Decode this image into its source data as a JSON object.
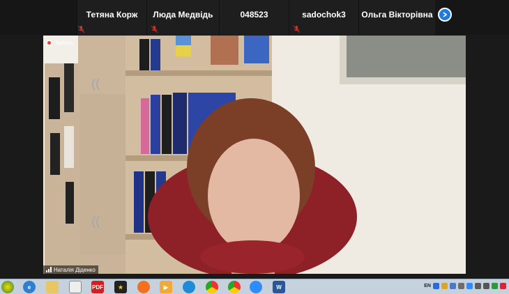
{
  "participants": [
    {
      "name": "Тетяна Корж"
    },
    {
      "name": "Люда Медвідь"
    },
    {
      "name": "048523"
    },
    {
      "name": "sadochok3"
    },
    {
      "name": "Ольга Вікторівна"
    }
  ],
  "recording": {
    "label": "Запись"
  },
  "active_speaker": {
    "name": "Наталія Діденко"
  },
  "taskbar": {
    "language": "EN",
    "apps": [
      "start",
      "ie",
      "explorer",
      "media-player",
      "pdf",
      "media-star",
      "firefox",
      "video-player",
      "edge",
      "chrome",
      "chrome-alt",
      "zoom",
      "word"
    ]
  },
  "colors": {
    "accent": "#1e7be0",
    "record": "#e9423a",
    "mic_muted": "#d0312d"
  }
}
